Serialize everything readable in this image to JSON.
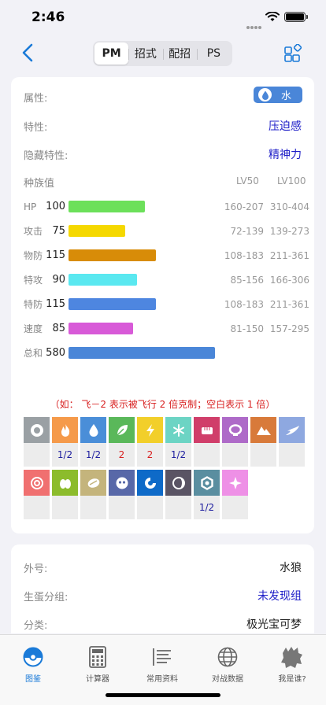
{
  "status": {
    "time": "2:46"
  },
  "nav": {
    "segments": [
      "PM",
      "招式",
      "配招",
      "PS"
    ],
    "active_segment": "PM"
  },
  "info": {
    "type_label": "属性:",
    "type_value": "水",
    "type_color": "#4a86d8",
    "ability_label": "特性:",
    "ability_value": "压迫感",
    "hidden_ability_label": "隐藏特性:",
    "hidden_ability_value": "精神力"
  },
  "stats": {
    "header": "种族值",
    "lv50_header": "LV50",
    "lv100_header": "LV100",
    "rows": [
      {
        "name": "HP",
        "value": 100,
        "lv50": "160-207",
        "lv100": "310-404",
        "color": "#6ce05a"
      },
      {
        "name": "攻击",
        "value": 75,
        "lv50": "72-139",
        "lv100": "139-273",
        "color": "#f5d800"
      },
      {
        "name": "物防",
        "value": 115,
        "lv50": "108-183",
        "lv100": "211-361",
        "color": "#d88c08"
      },
      {
        "name": "特攻",
        "value": 90,
        "lv50": "85-156",
        "lv100": "166-306",
        "color": "#5ae8f0"
      },
      {
        "name": "特防",
        "value": 115,
        "lv50": "108-183",
        "lv100": "211-361",
        "color": "#4e86e0"
      },
      {
        "name": "速度",
        "value": 85,
        "lv50": "81-150",
        "lv100": "157-295",
        "color": "#d85ad8"
      },
      {
        "name": "总和",
        "value": 580,
        "lv50": "",
        "lv100": "",
        "color": "#4a86d8"
      }
    ]
  },
  "effectiveness": {
    "note": "（如：  飞－2 表示被飞行 2 倍克制；空白表示 1 倍）",
    "row1": [
      {
        "type": "normal",
        "icon": "normal-type-icon",
        "color": "#9aa0a4",
        "value": ""
      },
      {
        "type": "fire",
        "icon": "fire-type-icon",
        "color": "#f59a4a",
        "value": "1/2"
      },
      {
        "type": "water",
        "icon": "water-type-icon",
        "color": "#4a8ed8",
        "value": "1/2"
      },
      {
        "type": "grass",
        "icon": "grass-type-icon",
        "color": "#5ab85a",
        "value": "2"
      },
      {
        "type": "electric",
        "icon": "electric-type-icon",
        "color": "#f2cf2a",
        "value": "2"
      },
      {
        "type": "ice",
        "icon": "ice-type-icon",
        "color": "#6cd4c4",
        "value": "1/2"
      },
      {
        "type": "fighting",
        "icon": "fighting-type-icon",
        "color": "#d03e6a",
        "value": ""
      },
      {
        "type": "poison",
        "icon": "poison-type-icon",
        "color": "#ae6ac8",
        "value": ""
      },
      {
        "type": "ground",
        "icon": "ground-type-icon",
        "color": "#d87a3a",
        "value": ""
      },
      {
        "type": "flying",
        "icon": "flying-type-icon",
        "color": "#8ea8e0",
        "value": ""
      }
    ],
    "row2": [
      {
        "type": "psychic",
        "icon": "psychic-type-icon",
        "color": "#f07070",
        "value": ""
      },
      {
        "type": "bug",
        "icon": "bug-type-icon",
        "color": "#8cbc2c",
        "value": ""
      },
      {
        "type": "rock",
        "icon": "rock-type-icon",
        "color": "#c4b47c",
        "value": ""
      },
      {
        "type": "ghost",
        "icon": "ghost-type-icon",
        "color": "#5868a8",
        "value": ""
      },
      {
        "type": "dragon",
        "icon": "dragon-type-icon",
        "color": "#0e6ac8",
        "value": ""
      },
      {
        "type": "dark",
        "icon": "dark-type-icon",
        "color": "#5a5464",
        "value": ""
      },
      {
        "type": "steel",
        "icon": "steel-type-icon",
        "color": "#5a8ea0",
        "value": "1/2"
      },
      {
        "type": "fairy",
        "icon": "fairy-type-icon",
        "color": "#ee90e6",
        "value": ""
      }
    ]
  },
  "details": {
    "nickname_label": "外号:",
    "nickname_value": "水狼",
    "egg_group_label": "生蛋分组:",
    "egg_group_value": "未发现组",
    "category_label": "分类:",
    "category_value": "极光宝可梦"
  },
  "tabbar": {
    "items": [
      {
        "label": "图鉴",
        "icon": "pokeball-icon",
        "active": true
      },
      {
        "label": "计算器",
        "icon": "calculator-icon",
        "active": false
      },
      {
        "label": "常用资料",
        "icon": "list-icon",
        "active": false
      },
      {
        "label": "对战数据",
        "icon": "globe-icon",
        "active": false
      },
      {
        "label": "我是谁?",
        "icon": "silhouette-icon",
        "active": false
      }
    ]
  }
}
